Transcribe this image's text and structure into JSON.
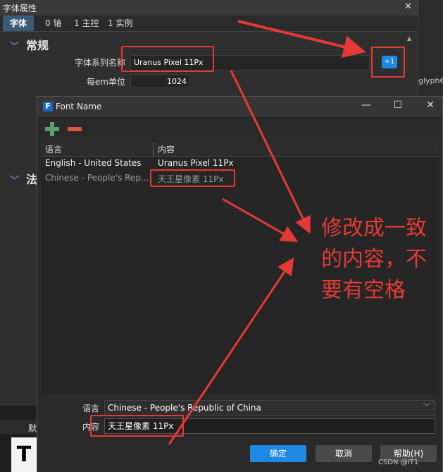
{
  "background_panel": {
    "title": "字体属性",
    "tabs": [
      "字体",
      "0 轴",
      "1 主控",
      "1 实例"
    ],
    "section_general": "常规",
    "section_other": "法",
    "family_name_label": "字体系列名称",
    "family_name_value": "Uranus Pixel 11Px",
    "units_per_em_label": "每em单位",
    "units_per_em_value": "1024",
    "plus_button": "+1",
    "glyph_text": "glyph6",
    "bottom_char": "T",
    "bottom_text": "默"
  },
  "dialog": {
    "title": "Font Name",
    "logo": "F",
    "columns": [
      "语言",
      "内容"
    ],
    "rows": [
      {
        "language": "English - United States",
        "content": "Uranus Pixel 11Px"
      },
      {
        "language": "Chinese - People's Rep...",
        "content": "天王星像素 11Px"
      }
    ],
    "language_label": "语言",
    "language_value": "Chinese - People's Republic of China",
    "content_label": "内容",
    "content_value": "天王星像素 11Px",
    "ok_label": "确定",
    "cancel_label": "取消",
    "help_label": "帮助(H)"
  },
  "annotation": {
    "text": "修改成一致的内容，不要有空格",
    "color": "#e53935"
  },
  "watermark": "CSDN @IT1"
}
